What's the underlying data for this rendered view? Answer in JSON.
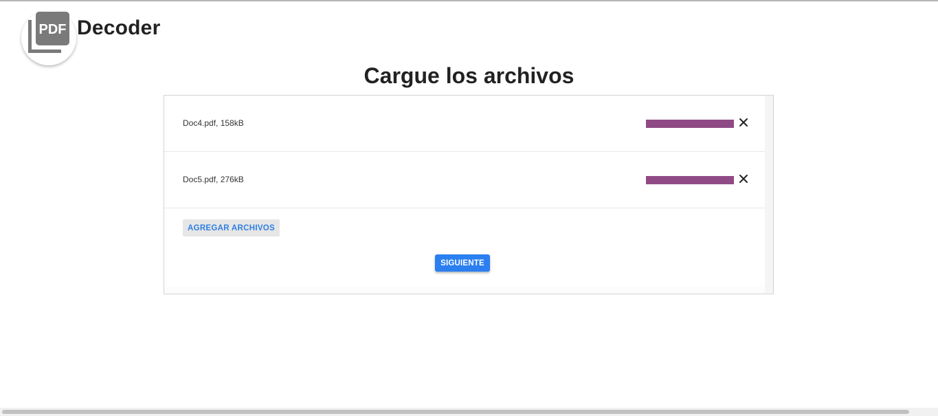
{
  "header": {
    "logo_text": "PDF",
    "brand": "Decoder"
  },
  "main": {
    "title": "Cargue los archivos",
    "files": [
      {
        "label": "Doc4.pdf, 158kB",
        "progress": 1.0
      },
      {
        "label": "Doc5.pdf, 276kB",
        "progress": 1.0
      }
    ],
    "add_files_label": "AGREGAR ARCHIVOS",
    "next_label": "SIGUIENTE"
  },
  "icons": {
    "logo": "pdf-stack-icon",
    "remove": "close-icon"
  },
  "colors": {
    "progress": "#8f4a85",
    "primary_button": "#2b7ff0",
    "link_text": "#2f7fe3",
    "logo_gray": "#7a7a7a"
  }
}
